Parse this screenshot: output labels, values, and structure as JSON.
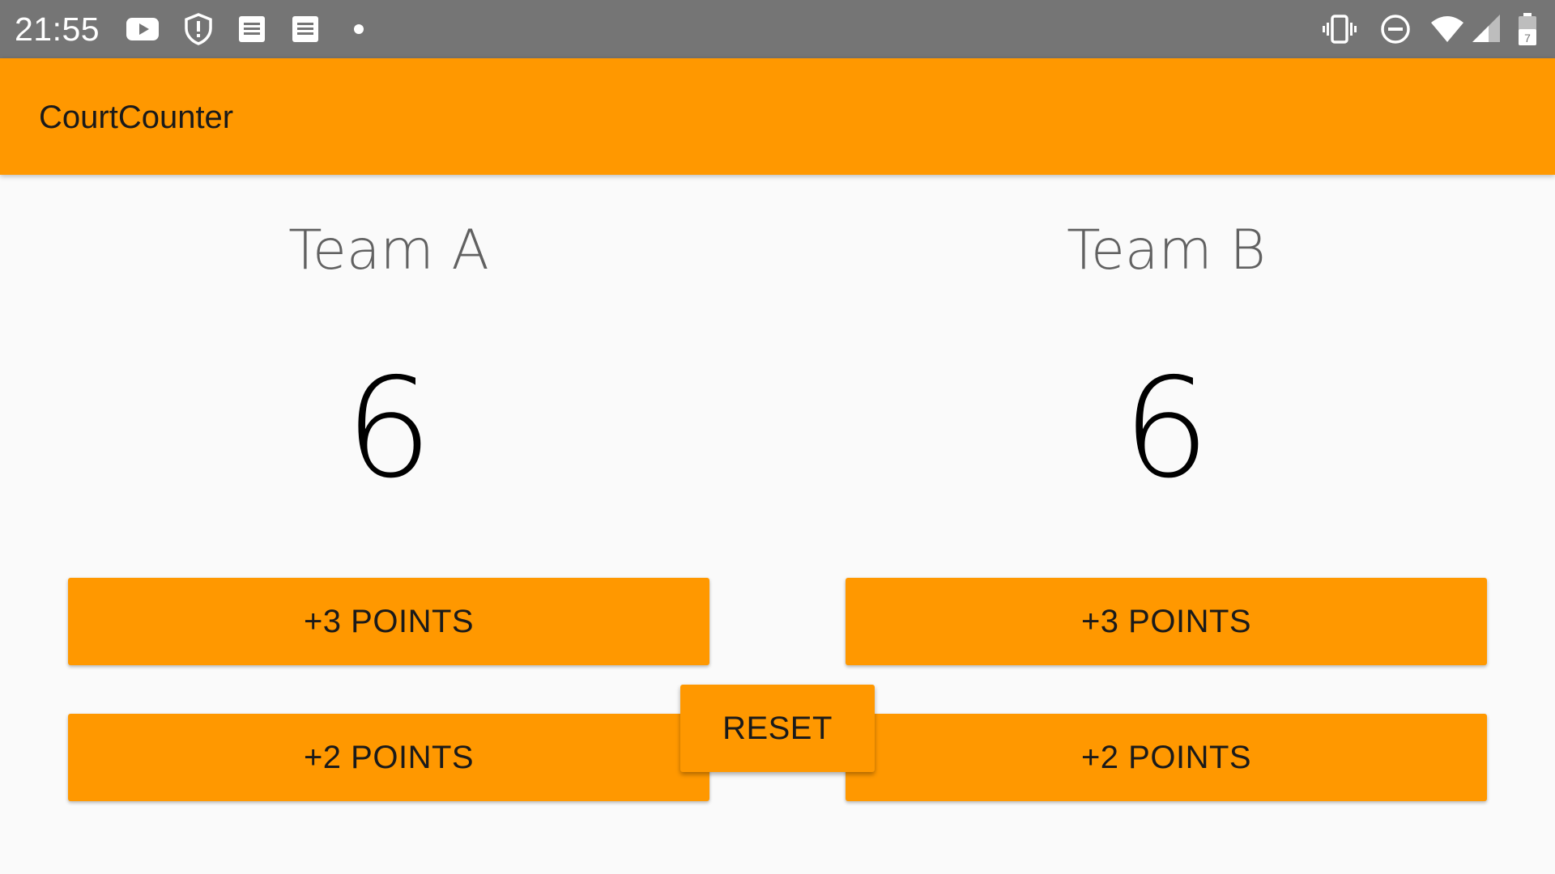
{
  "status_bar": {
    "time": "21:55",
    "left_icons": [
      "youtube-icon",
      "shield-alert-icon",
      "document-icon",
      "document-icon",
      "dot-icon"
    ],
    "right_icons": [
      "vibrate-icon",
      "do-not-disturb-icon",
      "wifi-icon",
      "cell-signal-icon",
      "battery-icon"
    ]
  },
  "app_bar": {
    "title": "CourtCounter",
    "color": "#ff9800"
  },
  "team_a": {
    "name": "Team A",
    "score": "6",
    "plus3_label": "+3 POINTS",
    "plus2_label": "+2 POINTS"
  },
  "team_b": {
    "name": "Team B",
    "score": "6",
    "plus3_label": "+3 POINTS",
    "plus2_label": "+2 POINTS"
  },
  "reset_label": "RESET",
  "colors": {
    "accent": "#ff9800",
    "status_bar": "#757575",
    "background": "#fafafa"
  }
}
